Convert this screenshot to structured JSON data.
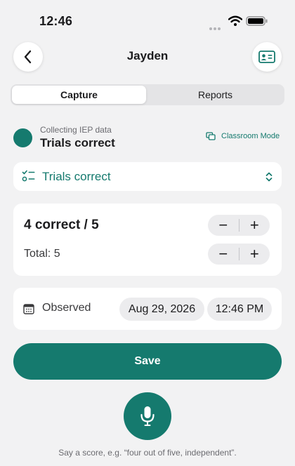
{
  "status_bar": {
    "time": "12:46"
  },
  "nav": {
    "title": "Jayden",
    "back_icon": "chevron-left-icon",
    "right_icon": "id-card-icon"
  },
  "tabs": [
    {
      "label": "Capture",
      "selected": true
    },
    {
      "label": "Reports",
      "selected": false
    }
  ],
  "collecting": {
    "caption": "Collecting IEP data",
    "title": "Trials correct",
    "mode_label": "Classroom Mode"
  },
  "goal_picker": {
    "selected": "Trials correct"
  },
  "counts": {
    "primary": "4 correct / 5",
    "total": "Total: 5"
  },
  "observed": {
    "label": "Observed",
    "date": "Aug 29, 2026",
    "time": "12:46 PM"
  },
  "save_label": "Save",
  "voice_hint": "Say a score, e.g. “four out of five, independent”.",
  "colors": {
    "accent": "#157a6e",
    "background": "#f2f2f3",
    "card": "#ffffff"
  }
}
